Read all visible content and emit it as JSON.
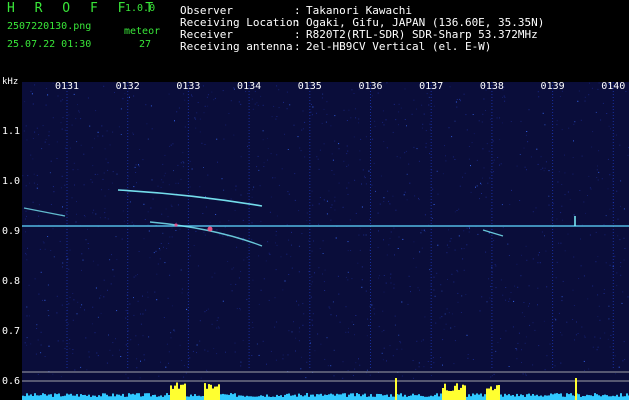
{
  "header": {
    "brand": "H R O F F T",
    "version": "1.0.0",
    "filename": "2507220130.png",
    "datetime": "25.07.22 01:30",
    "meteor_label": "meteor",
    "meteor_count": "27",
    "info": [
      {
        "key": "Observer",
        "sep": ":",
        "value": "Takanori Kawachi"
      },
      {
        "key": "Receiving Location",
        "sep": ":",
        "value": "Ogaki, Gifu, JAPAN (136.60E, 35.35N)"
      },
      {
        "key": "Receiver",
        "sep": ":",
        "value": "R820T2(RTL-SDR) SDR-Sharp 53.372MHz"
      },
      {
        "key": "Receiving antenna",
        "sep": ":",
        "value": "2el-HB9CV Vertical (el. E-W)"
      }
    ]
  },
  "spectrogram": {
    "y_unit": "kHz",
    "y_ticks": [
      "1.1",
      "1.0",
      "0.9",
      "0.8",
      "0.7",
      "0.6"
    ],
    "x_ticks": [
      "0131",
      "0132",
      "0133",
      "0134",
      "0135",
      "0136",
      "0137",
      "0138",
      "0139",
      "0140"
    ],
    "colors": {
      "background": "#0a0d3a",
      "grid": "#1e3cc8",
      "signal": "#7cf0ff",
      "bars": "#ffff30",
      "baseline": "#30c8ff"
    }
  }
}
